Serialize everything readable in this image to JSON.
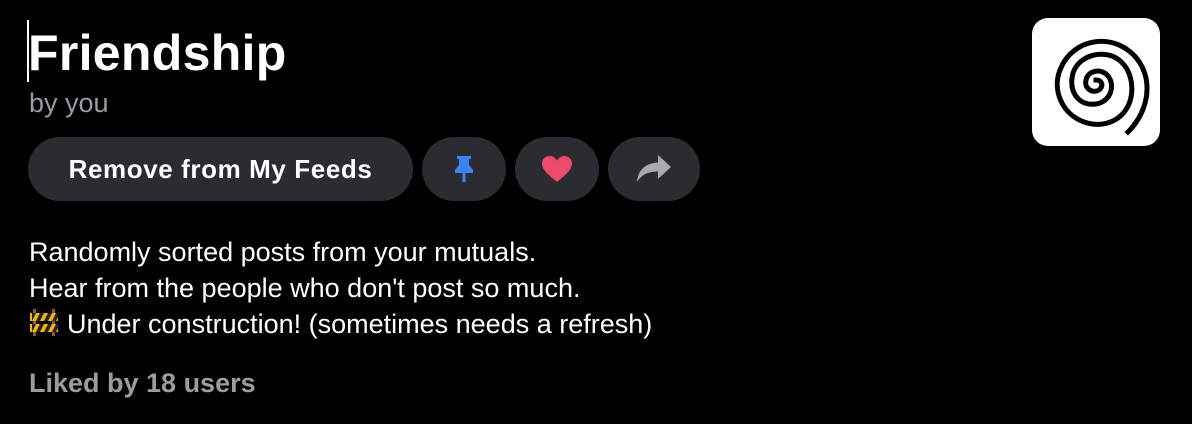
{
  "feed": {
    "title": "Friendship",
    "byline": "by you",
    "avatar_icon": "spiral-icon"
  },
  "actions": {
    "remove_label": "Remove from My Feeds",
    "pin_icon": "pin-icon",
    "like_icon": "heart-icon",
    "share_icon": "share-arrow-icon"
  },
  "description": {
    "line1": "Randomly sorted posts from your mutuals.",
    "line2": "Hear from the people who don't post so much.",
    "line3_emoji": "construction-sign-icon",
    "line3": "Under construction! (sometimes needs a refresh)"
  },
  "likes": {
    "text": "Liked by 18 users"
  },
  "colors": {
    "background": "#000000",
    "button_bg": "#2b2c31",
    "muted_text": "#9a9ca3",
    "pin_blue": "#3b82f6",
    "heart_red": "#ec4a6a",
    "share_gray": "#a8aab0"
  }
}
